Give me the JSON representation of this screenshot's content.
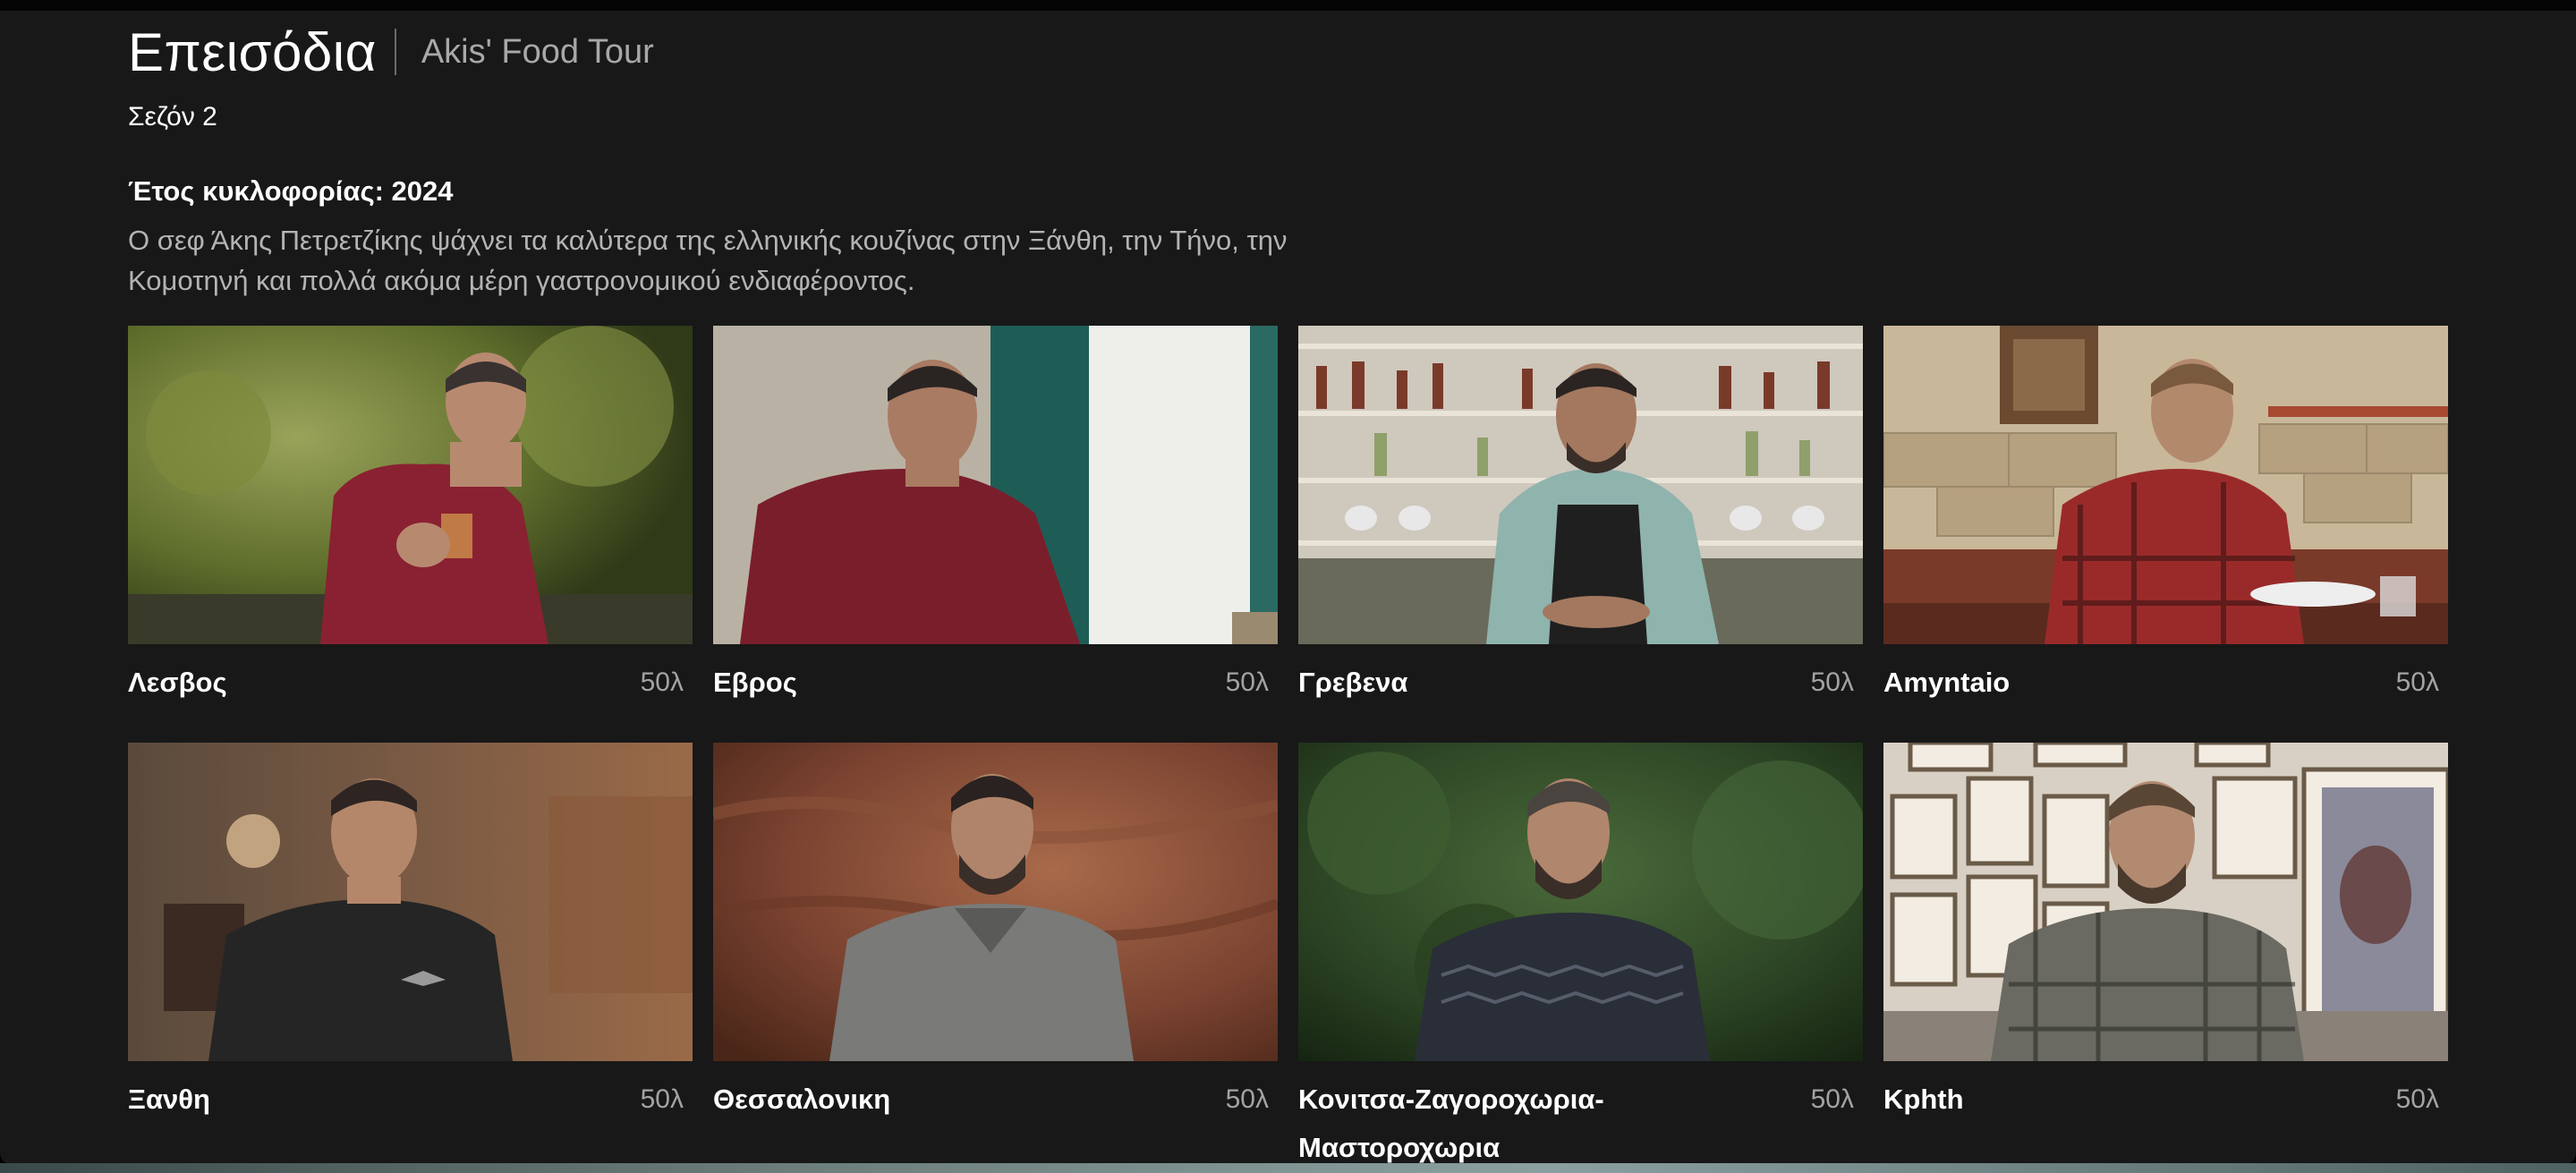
{
  "header": {
    "title": "Επεισόδια",
    "show_name": "Akis' Food Tour"
  },
  "season_label": "Σεζόν 2",
  "release_label": "Έτος κυκλοφορίας: 2024",
  "description": "Ο σεφ Άκης Πετρετζίκης ψάχνει τα καλύτερα της ελληνικής κουζίνας στην Ξάνθη, την Τήνο, την Κομοτηνή και πολλά ακόμα μέρη γαστρονομικού ενδιαφέροντος.",
  "episodes": [
    {
      "title": "Λεσβος",
      "duration": "50λ"
    },
    {
      "title": "Εβρος",
      "duration": "50λ"
    },
    {
      "title": "Γρεβενα",
      "duration": "50λ"
    },
    {
      "title": "Amyntaio",
      "duration": "50λ"
    },
    {
      "title": "Ξανθη",
      "duration": "50λ"
    },
    {
      "title": "Θεσσαλονικη",
      "duration": "50λ"
    },
    {
      "title": "Κονιτσα-Ζαγοροχωρια-Μαστοροχωρια",
      "duration": "50λ"
    },
    {
      "title": "Kphth",
      "duration": "50λ"
    }
  ],
  "colors": {
    "background": "#181818",
    "text_primary": "#ffffff",
    "text_secondary": "#a3a3a3"
  }
}
